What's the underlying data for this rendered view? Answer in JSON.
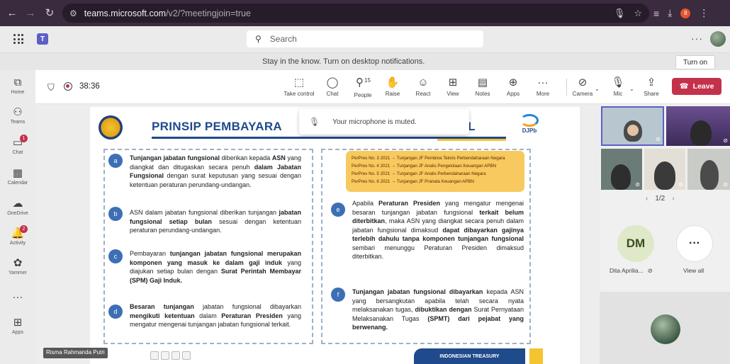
{
  "browser": {
    "url_host": "teams.microsoft.com",
    "url_rest": "/v2/?meetingjoin=true",
    "profile_initial": "8"
  },
  "header": {
    "search_placeholder": "Search"
  },
  "notification": {
    "text": "Stay in the know. Turn on desktop notifications.",
    "button_label": "Turn on"
  },
  "rail": {
    "items": [
      {
        "label": "Home"
      },
      {
        "label": "Teams"
      },
      {
        "label": "Chat",
        "badge": "1"
      },
      {
        "label": "Calendar"
      },
      {
        "label": "OneDrive"
      },
      {
        "label": "Activity",
        "badge": "2"
      },
      {
        "label": "Yammer"
      },
      {
        "label": "Apps"
      }
    ]
  },
  "toolbar": {
    "timer": "38:36",
    "buttons": [
      {
        "label": "Take control"
      },
      {
        "label": "Chat"
      },
      {
        "label": "People",
        "count": "15"
      },
      {
        "label": "Raise"
      },
      {
        "label": "React"
      },
      {
        "label": "View"
      },
      {
        "label": "Notes"
      },
      {
        "label": "Apps"
      },
      {
        "label": "More"
      },
      {
        "label": "Camera"
      },
      {
        "label": "Mic"
      },
      {
        "label": "Share"
      }
    ],
    "leave_label": "Leave"
  },
  "toast": {
    "text": "Your microphone is muted."
  },
  "slide": {
    "title_start": "PRINSIP PEMBAYARA",
    "title_end": "AL",
    "logo_text": "DJPb",
    "footer_text": "INDONESIAN TREASURY",
    "perpres": [
      "PerPres No. 3 2021 → Tunjangan JF Pembina Teknis Perbendaharaan Negara",
      "PerPres No. 4 2021 → Tunjangan JF Analis Pengelolaan Keuangan APBN",
      "PerPres No. 5 2021 → Tunjangan JF Analis Perbendaharaan Negara",
      "PerPres No. 6 2021 → Tunjangan JF Pranata Keuangan APBN"
    ],
    "items": [
      {
        "letter": "a"
      },
      {
        "letter": "b"
      },
      {
        "letter": "c"
      },
      {
        "letter": "d"
      },
      {
        "letter": "e"
      },
      {
        "letter": "f"
      }
    ]
  },
  "presenter": {
    "name": "Risma Rahmanda Putri"
  },
  "participants": {
    "pager": "1/2",
    "dm_initials": "DM",
    "dm_name": "Dita Aprilia...",
    "view_all_label": "View all"
  }
}
